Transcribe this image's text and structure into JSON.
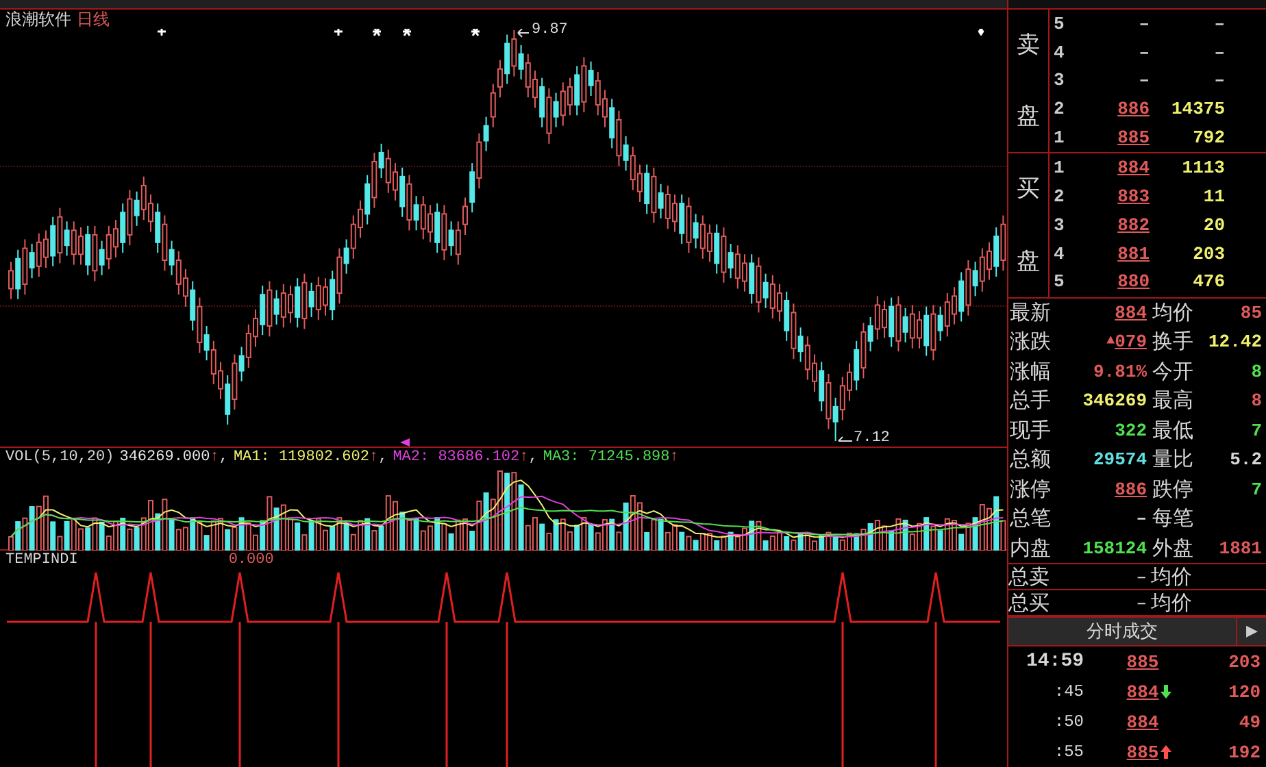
{
  "title": {
    "name": "浪潮软件",
    "period": "日线"
  },
  "chart": {
    "high_label": "9.87",
    "low_label": "7.12",
    "chart_data": {
      "type": "candlestick",
      "ohlc": [
        [
          8.14,
          8.32,
          8.07,
          8.26
        ],
        [
          8.34,
          8.4,
          8.07,
          8.14
        ],
        [
          8.17,
          8.47,
          8.1,
          8.41
        ],
        [
          8.38,
          8.44,
          8.21,
          8.28
        ],
        [
          8.29,
          8.51,
          8.22,
          8.45
        ],
        [
          8.35,
          8.53,
          8.28,
          8.47
        ],
        [
          8.56,
          8.62,
          8.29,
          8.36
        ],
        [
          8.38,
          8.68,
          8.31,
          8.62
        ],
        [
          8.53,
          8.59,
          8.36,
          8.43
        ],
        [
          8.37,
          8.59,
          8.3,
          8.53
        ],
        [
          8.37,
          8.55,
          8.3,
          8.49
        ],
        [
          8.5,
          8.56,
          8.23,
          8.3
        ],
        [
          8.26,
          8.56,
          8.19,
          8.5
        ],
        [
          8.4,
          8.46,
          8.23,
          8.3
        ],
        [
          8.34,
          8.56,
          8.27,
          8.5
        ],
        [
          8.42,
          8.6,
          8.35,
          8.54
        ],
        [
          8.65,
          8.71,
          8.38,
          8.45
        ],
        [
          8.5,
          8.8,
          8.43,
          8.74
        ],
        [
          8.73,
          8.79,
          8.56,
          8.63
        ],
        [
          8.67,
          8.89,
          8.6,
          8.83
        ],
        [
          8.59,
          8.77,
          8.52,
          8.71
        ],
        [
          8.65,
          8.71,
          8.38,
          8.45
        ],
        [
          8.33,
          8.63,
          8.26,
          8.57
        ],
        [
          8.4,
          8.46,
          8.23,
          8.3
        ],
        [
          8.17,
          8.39,
          8.1,
          8.33
        ],
        [
          8.09,
          8.27,
          8.02,
          8.21
        ],
        [
          8.13,
          8.19,
          7.86,
          7.93
        ],
        [
          7.78,
          8.08,
          7.71,
          8.02
        ],
        [
          7.83,
          7.89,
          7.66,
          7.73
        ],
        [
          7.57,
          7.79,
          7.5,
          7.73
        ],
        [
          7.47,
          7.65,
          7.4,
          7.59
        ],
        [
          7.5,
          7.56,
          7.23,
          7.3
        ],
        [
          7.4,
          7.7,
          7.33,
          7.64
        ],
        [
          7.69,
          7.75,
          7.52,
          7.59
        ],
        [
          7.68,
          7.9,
          7.61,
          7.84
        ],
        [
          7.82,
          8.0,
          7.75,
          7.94
        ],
        [
          8.1,
          8.16,
          7.83,
          7.9
        ],
        [
          7.89,
          8.19,
          7.82,
          8.13
        ],
        [
          8.07,
          8.13,
          7.9,
          7.97
        ],
        [
          7.95,
          8.17,
          7.88,
          8.11
        ],
        [
          7.98,
          8.16,
          7.91,
          8.1
        ],
        [
          8.15,
          8.21,
          7.88,
          7.95
        ],
        [
          7.94,
          8.24,
          7.87,
          8.18
        ],
        [
          8.12,
          8.18,
          7.95,
          8.02
        ],
        [
          8.0,
          8.22,
          7.93,
          8.16
        ],
        [
          8.03,
          8.21,
          7.96,
          8.15
        ],
        [
          8.2,
          8.26,
          7.93,
          8.0
        ],
        [
          8.11,
          8.41,
          8.04,
          8.35
        ],
        [
          8.41,
          8.47,
          8.24,
          8.31
        ],
        [
          8.41,
          8.63,
          8.34,
          8.57
        ],
        [
          8.55,
          8.73,
          8.48,
          8.67
        ],
        [
          8.84,
          8.9,
          8.57,
          8.64
        ],
        [
          8.75,
          9.05,
          8.68,
          8.99
        ],
        [
          9.05,
          9.11,
          8.88,
          8.95
        ],
        [
          8.85,
          9.07,
          8.78,
          9.01
        ],
        [
          8.8,
          8.98,
          8.73,
          8.92
        ],
        [
          8.89,
          8.95,
          8.62,
          8.69
        ],
        [
          8.6,
          8.9,
          8.53,
          8.84
        ],
        [
          8.7,
          8.76,
          8.53,
          8.6
        ],
        [
          8.54,
          8.76,
          8.47,
          8.7
        ],
        [
          8.52,
          8.7,
          8.45,
          8.64
        ],
        [
          8.65,
          8.71,
          8.38,
          8.45
        ],
        [
          8.4,
          8.7,
          8.33,
          8.64
        ],
        [
          8.53,
          8.59,
          8.36,
          8.43
        ],
        [
          8.37,
          8.59,
          8.3,
          8.53
        ],
        [
          8.57,
          8.75,
          8.5,
          8.69
        ],
        [
          8.92,
          8.98,
          8.65,
          8.72
        ],
        [
          8.88,
          9.18,
          8.81,
          9.12
        ],
        [
          9.23,
          9.29,
          9.06,
          9.13
        ],
        [
          9.29,
          9.51,
          9.22,
          9.45
        ],
        [
          9.49,
          9.67,
          9.42,
          9.61
        ],
        [
          9.78,
          9.84,
          9.51,
          9.58
        ],
        [
          9.63,
          9.87,
          9.56,
          9.81
        ],
        [
          9.71,
          9.77,
          9.54,
          9.61
        ],
        [
          9.49,
          9.71,
          9.42,
          9.65
        ],
        [
          9.42,
          9.6,
          9.35,
          9.54
        ],
        [
          9.49,
          9.55,
          9.22,
          9.29
        ],
        [
          9.18,
          9.48,
          9.11,
          9.42
        ],
        [
          9.39,
          9.45,
          9.22,
          9.29
        ],
        [
          9.3,
          9.52,
          9.23,
          9.46
        ],
        [
          9.37,
          9.55,
          9.3,
          9.49
        ],
        [
          9.57,
          9.63,
          9.3,
          9.37
        ],
        [
          9.39,
          9.69,
          9.32,
          9.63
        ],
        [
          9.6,
          9.66,
          9.43,
          9.5
        ],
        [
          9.37,
          9.59,
          9.3,
          9.53
        ],
        [
          9.29,
          9.47,
          9.22,
          9.41
        ],
        [
          9.35,
          9.41,
          9.08,
          9.15
        ],
        [
          9.03,
          9.33,
          8.96,
          9.27
        ],
        [
          9.1,
          9.16,
          8.93,
          9.0
        ],
        [
          8.87,
          9.09,
          8.8,
          9.03
        ],
        [
          8.79,
          8.97,
          8.72,
          8.91
        ],
        [
          8.91,
          8.97,
          8.64,
          8.71
        ],
        [
          8.65,
          8.95,
          8.58,
          8.89
        ],
        [
          8.78,
          8.84,
          8.61,
          8.68
        ],
        [
          8.61,
          8.83,
          8.54,
          8.77
        ],
        [
          8.59,
          8.77,
          8.52,
          8.71
        ],
        [
          8.71,
          8.77,
          8.44,
          8.51
        ],
        [
          8.45,
          8.75,
          8.38,
          8.69
        ],
        [
          8.58,
          8.64,
          8.41,
          8.48
        ],
        [
          8.41,
          8.63,
          8.34,
          8.57
        ],
        [
          8.39,
          8.57,
          8.32,
          8.51
        ],
        [
          8.51,
          8.57,
          8.24,
          8.31
        ],
        [
          8.25,
          8.55,
          8.18,
          8.49
        ],
        [
          8.38,
          8.44,
          8.21,
          8.28
        ],
        [
          8.21,
          8.43,
          8.14,
          8.37
        ],
        [
          8.19,
          8.37,
          8.12,
          8.31
        ],
        [
          8.31,
          8.37,
          8.04,
          8.11
        ],
        [
          8.05,
          8.35,
          7.98,
          8.29
        ],
        [
          8.18,
          8.24,
          8.01,
          8.08
        ],
        [
          8.01,
          8.23,
          7.94,
          8.17
        ],
        [
          7.99,
          8.17,
          7.92,
          8.11
        ],
        [
          8.06,
          8.12,
          7.79,
          7.86
        ],
        [
          7.74,
          8.04,
          7.67,
          7.98
        ],
        [
          7.82,
          7.88,
          7.65,
          7.72
        ],
        [
          7.6,
          7.82,
          7.53,
          7.76
        ],
        [
          7.52,
          7.7,
          7.45,
          7.64
        ],
        [
          7.59,
          7.65,
          7.32,
          7.39
        ],
        [
          7.27,
          7.57,
          7.2,
          7.51
        ],
        [
          7.35,
          7.41,
          7.12,
          7.25
        ],
        [
          7.33,
          7.55,
          7.26,
          7.49
        ],
        [
          7.46,
          7.64,
          7.39,
          7.58
        ],
        [
          7.73,
          7.79,
          7.46,
          7.53
        ],
        [
          7.61,
          7.91,
          7.54,
          7.85
        ],
        [
          7.89,
          7.95,
          7.72,
          7.79
        ],
        [
          7.87,
          8.09,
          7.8,
          8.03
        ],
        [
          7.88,
          8.06,
          7.81,
          8.0
        ],
        [
          8.02,
          8.08,
          7.75,
          7.82
        ],
        [
          7.79,
          8.09,
          7.72,
          8.03
        ],
        [
          7.95,
          8.01,
          7.78,
          7.85
        ],
        [
          7.81,
          8.03,
          7.74,
          7.97
        ],
        [
          7.81,
          7.99,
          7.74,
          7.93
        ],
        [
          7.96,
          8.02,
          7.69,
          7.76
        ],
        [
          7.73,
          8.03,
          7.66,
          7.97
        ],
        [
          7.96,
          8.02,
          7.79,
          7.86
        ],
        [
          7.89,
          8.11,
          7.82,
          8.05
        ],
        [
          7.97,
          8.15,
          7.9,
          8.09
        ],
        [
          8.19,
          8.25,
          7.92,
          7.99
        ],
        [
          8.03,
          8.33,
          7.96,
          8.27
        ],
        [
          8.26,
          8.32,
          8.09,
          8.16
        ],
        [
          8.19,
          8.41,
          8.12,
          8.35
        ],
        [
          8.27,
          8.45,
          8.2,
          8.39
        ],
        [
          8.49,
          8.55,
          8.22,
          8.29
        ],
        [
          8.33,
          8.63,
          8.26,
          8.57
        ]
      ]
    }
  },
  "volume": {
    "name": "VOL(5,10,20)",
    "arrow": "↑",
    "readings": [
      {
        "value": "346269.000",
        "color": "#e8e8e8",
        "separator": ","
      },
      {
        "label": "MA1:",
        "value": "119802.602",
        "color": "#f0f070",
        "separator": ","
      },
      {
        "label": "MA2:",
        "value": "83686.102",
        "color": "#e040e0",
        "separator": ","
      },
      {
        "label": "MA3:",
        "value": "71245.898",
        "color": "#50e050"
      }
    ]
  },
  "indicator": {
    "name": "TEMPINDI",
    "value": "0.000"
  },
  "sell": {
    "label_top": "卖",
    "label_bottom": "盘",
    "rows": [
      {
        "level": "5",
        "price": "–",
        "volume": "–"
      },
      {
        "level": "4",
        "price": "–",
        "volume": "–"
      },
      {
        "level": "3",
        "price": "–",
        "volume": "–"
      },
      {
        "level": "2",
        "price": "886",
        "volume": "14375"
      },
      {
        "level": "1",
        "price": "885",
        "volume": "792"
      }
    ]
  },
  "buy": {
    "label_top": "买",
    "label_bottom": "盘",
    "rows": [
      {
        "level": "1",
        "price": "884",
        "volume": "1113"
      },
      {
        "level": "2",
        "price": "883",
        "volume": "11"
      },
      {
        "level": "3",
        "price": "882",
        "volume": "20"
      },
      {
        "level": "4",
        "price": "881",
        "volume": "203"
      },
      {
        "level": "5",
        "price": "880",
        "volume": "476"
      }
    ]
  },
  "stats": [
    {
      "cells": [
        {
          "label": "最新",
          "value": "884",
          "color": "#e05a5a",
          "underlined": true,
          "arrow": false
        },
        {
          "label": "均价",
          "value": "85",
          "color": "#e05a5a",
          "underlined": false,
          "arrow": false
        }
      ]
    },
    {
      "cells": [
        {
          "label": "涨跌",
          "value": "079",
          "color": "#e05a5a",
          "underlined": true,
          "arrow": "▲"
        },
        {
          "label": "换手",
          "value": "12.42",
          "color": "#f0f070",
          "underlined": false,
          "arrow": false
        }
      ]
    },
    {
      "cells": [
        {
          "label": "涨幅",
          "value": "9.81%",
          "color": "#e05a5a",
          "underlined": false,
          "arrow": false
        },
        {
          "label": "今开",
          "value": "8",
          "color": "#50e050",
          "underlined": false,
          "arrow": false
        }
      ]
    },
    {
      "cells": [
        {
          "label": "总手",
          "value": "346269",
          "color": "#f0f070",
          "underlined": false,
          "arrow": false
        },
        {
          "label": "最高",
          "value": "8",
          "color": "#e05a5a",
          "underlined": false,
          "arrow": false
        }
      ]
    },
    {
      "cells": [
        {
          "label": "现手",
          "value": "322",
          "color": "#50e050",
          "underlined": false,
          "arrow": false
        },
        {
          "label": "最低",
          "value": "7",
          "color": "#50e050",
          "underlined": false,
          "arrow": false
        }
      ]
    },
    {
      "cells": [
        {
          "label": "总额",
          "value": "29574",
          "color": "#60e0e0",
          "underlined": false,
          "arrow": false
        },
        {
          "label": "量比",
          "value": "5.2",
          "color": "#d8d8d8",
          "underlined": false,
          "arrow": false
        }
      ]
    },
    {
      "cells": [
        {
          "label": "涨停",
          "value": "886",
          "color": "#e05a5a",
          "underlined": true,
          "arrow": false
        },
        {
          "label": "跌停",
          "value": "7",
          "color": "#50e050",
          "underlined": false,
          "arrow": false
        }
      ]
    },
    {
      "cells": [
        {
          "label": "总笔",
          "value": "–",
          "color": "#d8d8d8",
          "underlined": false,
          "arrow": false
        },
        {
          "label": "每笔"
        }
      ]
    },
    {
      "cells": [
        {
          "label": "内盘",
          "value": "158124",
          "color": "#50e050",
          "underlined": false,
          "arrow": false
        },
        {
          "label": "外盘",
          "value": "1881",
          "color": "#e05a5a",
          "underlined": false,
          "arrow": false
        }
      ]
    }
  ],
  "totals": [
    {
      "label": "总卖",
      "value": "–",
      "avg_label": "均价"
    },
    {
      "label": "总买",
      "value": "–",
      "avg_label": "均价"
    }
  ],
  "ticks": {
    "title": "分时成交",
    "play": "▶",
    "rows": [
      {
        "time": "14:59",
        "price": "885",
        "kind": "plain",
        "volume": "203"
      },
      {
        "time": ":45",
        "price": "884",
        "kind": "down",
        "volume": "120"
      },
      {
        "time": ":50",
        "price": "884",
        "kind": "plain",
        "volume": "49"
      },
      {
        "time": ":55",
        "price": "885",
        "kind": "up",
        "volume": "192"
      }
    ]
  }
}
